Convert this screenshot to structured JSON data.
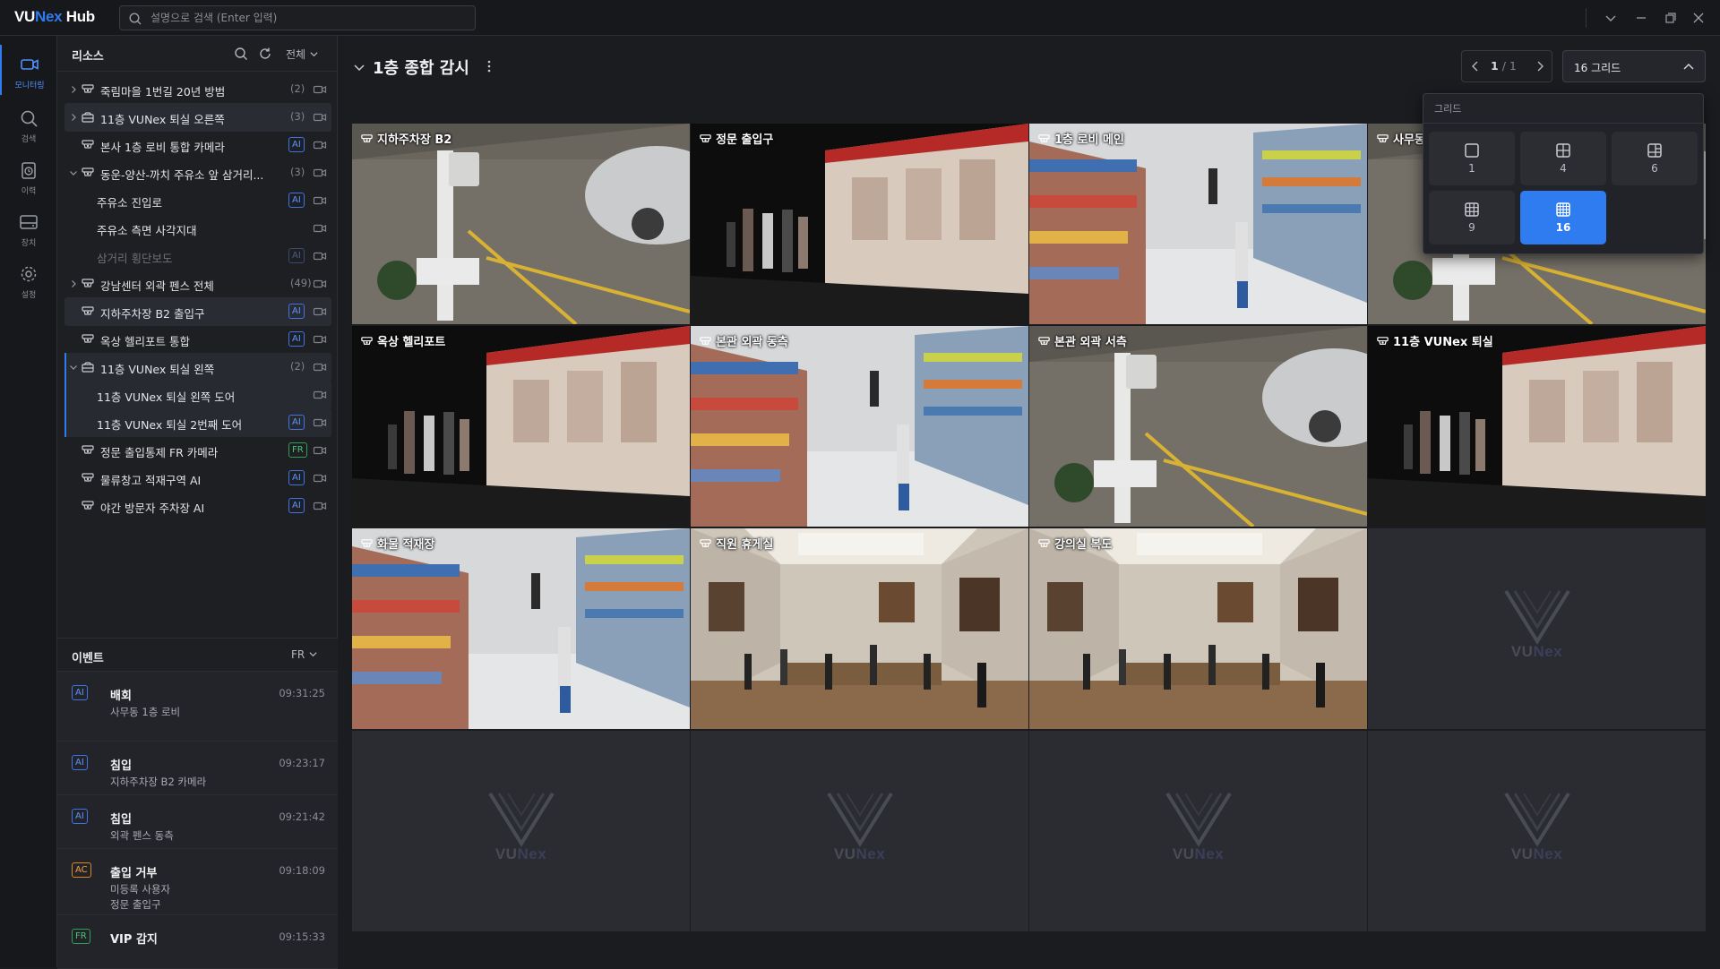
{
  "app": {
    "logo_prefix": "VU",
    "logo_brand": "Nex",
    "logo_suffix": " Hub"
  },
  "search": {
    "placeholder": "설명으로 검색 (Enter 입력)"
  },
  "rail": [
    {
      "label": "모니터링",
      "icon": "camera-icon",
      "active": true
    },
    {
      "label": "검색",
      "icon": "search-icon"
    },
    {
      "label": "이력",
      "icon": "history-icon"
    },
    {
      "label": "장치",
      "icon": "storage-icon"
    },
    {
      "label": "설정",
      "icon": "gear-icon"
    }
  ],
  "resources": {
    "title": "리소스",
    "filter": "전체",
    "items": [
      {
        "name": "죽림마을 1번길 20년 방범",
        "count": "(2)",
        "chev": "right",
        "icon": "camera-group-icon",
        "level": 0
      },
      {
        "name": "11층 VUNex 퇴실 오른쪽",
        "count": "(3)",
        "chev": "right",
        "icon": "folder-icon",
        "level": 0,
        "highlight": true
      },
      {
        "name": "본사 1층 로비 통합 카메라",
        "badge": "AI",
        "icon": "camera-group-icon",
        "level": 0
      },
      {
        "name": "동운-양산-까치 주유소 앞 삼거리...",
        "count": "(3)",
        "chev": "down",
        "icon": "camera-group-icon",
        "level": 0
      },
      {
        "name": "주유소 진입로",
        "badge": "AI",
        "level": 1
      },
      {
        "name": "주유소 측면 사각지대",
        "level": 1
      },
      {
        "name": "삼거리 횡단보도",
        "badge": "AI",
        "level": 1,
        "dim": true
      },
      {
        "name": "강남센터 외곽 펜스 전체",
        "count": "(49)",
        "chev": "right",
        "icon": "camera-group-icon",
        "level": 0
      },
      {
        "name": "지하주차장 B2 출입구",
        "badge": "AI",
        "icon": "camera-group-icon",
        "level": 0,
        "highlight": true
      },
      {
        "name": "옥상 헬리포트 통합",
        "badge": "AI",
        "icon": "camera-group-icon",
        "level": 0
      },
      {
        "name": "11층 VUNex 퇴실 왼쪽",
        "count": "(2)",
        "chev": "down",
        "icon": "folder-icon",
        "level": 0,
        "group": true
      },
      {
        "name": "11층 VUNex 퇴실 왼쪽 도어",
        "level": 1,
        "group": true
      },
      {
        "name": "11층 VUNex 퇴실 2번째 도어",
        "badge": "AI",
        "level": 1,
        "group": true
      },
      {
        "name": "정문 출입통제 FR 카메라",
        "badge": "FR",
        "icon": "camera-group-icon",
        "level": 0
      },
      {
        "name": "물류창고 적재구역 AI",
        "badge": "AI",
        "icon": "camera-group-icon",
        "level": 0
      },
      {
        "name": "야간 방문자 주차장 AI",
        "badge": "AI",
        "icon": "camera-group-icon",
        "level": 0
      }
    ]
  },
  "events": {
    "title": "이벤트",
    "filter": "FR",
    "items": [
      {
        "badge": "AI",
        "title": "배회",
        "time": "09:31:25",
        "lines": [
          "사무동 1층 로비"
        ]
      },
      {
        "badge": "AI",
        "title": "침입",
        "time": "09:23:17",
        "lines": [
          "지하주차장 B2 카메라"
        ]
      },
      {
        "badge": "AI",
        "title": "침입",
        "time": "09:21:42",
        "lines": [
          "외곽 펜스 동측"
        ]
      },
      {
        "badge": "AC",
        "title": "출입 거부",
        "time": "09:18:09",
        "lines": [
          "미등록 사용자",
          "정문 출입구"
        ]
      },
      {
        "badge": "FR",
        "title": "VIP 감지",
        "time": "09:15:33",
        "lines": []
      }
    ]
  },
  "view": {
    "title": "1층 종합 감시",
    "page_current": "1",
    "page_total": "/ 1",
    "grid_label": "16 그리드"
  },
  "tiles": [
    {
      "label": "지하주차장 B2",
      "scene": "parking"
    },
    {
      "label": "정문 출입구",
      "scene": "gallery"
    },
    {
      "label": "1층 로비 메인",
      "scene": "market"
    },
    {
      "label": "사무동",
      "scene": "parking"
    },
    {
      "label": "옥상 헬리포트",
      "scene": "gallery"
    },
    {
      "label": "본관 외곽 동측",
      "scene": "market"
    },
    {
      "label": "본관 외곽 서측",
      "scene": "parking"
    },
    {
      "label": "11층 VUNex 퇴실",
      "scene": "gallery"
    },
    {
      "label": "화물 적재장",
      "scene": "market"
    },
    {
      "label": "직원 휴게실",
      "scene": "museum"
    },
    {
      "label": "강의실 복도",
      "scene": "museum"
    },
    {
      "label": "",
      "scene": "empty"
    },
    {
      "label": "",
      "scene": "empty"
    },
    {
      "label": "",
      "scene": "empty"
    },
    {
      "label": "",
      "scene": "empty"
    },
    {
      "label": "",
      "scene": "empty"
    }
  ],
  "watermark": {
    "prefix": "VU",
    "brand": "Nex"
  },
  "grid_popover": {
    "title": "그리드",
    "options": [
      {
        "label": "1",
        "icon": "grid-1-icon"
      },
      {
        "label": "4",
        "icon": "grid-4-icon"
      },
      {
        "label": "6",
        "icon": "grid-6-icon"
      },
      {
        "label": "9",
        "icon": "grid-9-icon"
      },
      {
        "label": "16",
        "icon": "grid-16-icon",
        "selected": true
      }
    ]
  },
  "colors": {
    "accent": "#2f7bf0",
    "ai": "#5d93ff",
    "fr": "#47c374",
    "ac": "#f0a23a"
  }
}
